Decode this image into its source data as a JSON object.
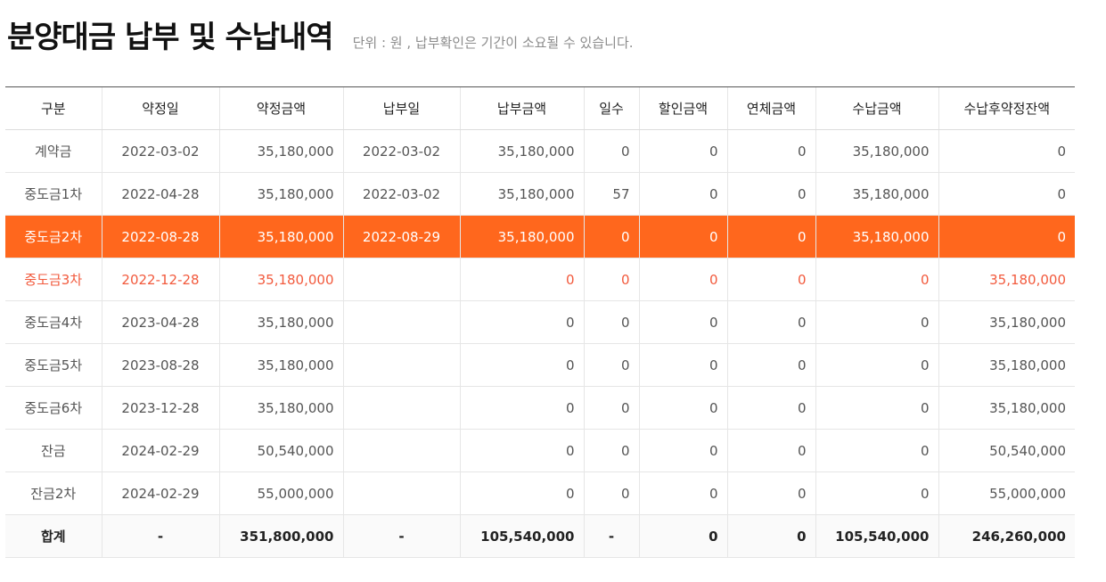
{
  "header": {
    "title": "분양대금 납부 및 수납내역",
    "subtitle": "단위 : 원 , 납부확인은 기간이 소요될 수 있습니다."
  },
  "colors": {
    "highlight_row": "#ff671d",
    "due_text": "#f25a3d"
  },
  "table": {
    "columns": [
      "구분",
      "약정일",
      "약정금액",
      "납부일",
      "납부금액",
      "일수",
      "할인금액",
      "연체금액",
      "수납금액",
      "수납후약정잔액"
    ],
    "rows": [
      [
        "계약금",
        "2022-03-02",
        "35,180,000",
        "2022-03-02",
        "35,180,000",
        "0",
        "0",
        "0",
        "35,180,000",
        "0"
      ],
      [
        "중도금1차",
        "2022-04-28",
        "35,180,000",
        "2022-03-02",
        "35,180,000",
        "57",
        "0",
        "0",
        "35,180,000",
        "0"
      ],
      [
        "중도금2차",
        "2022-08-28",
        "35,180,000",
        "2022-08-29",
        "35,180,000",
        "0",
        "0",
        "0",
        "35,180,000",
        "0"
      ],
      [
        "중도금3차",
        "2022-12-28",
        "35,180,000",
        "",
        "0",
        "0",
        "0",
        "0",
        "0",
        "35,180,000"
      ],
      [
        "중도금4차",
        "2023-04-28",
        "35,180,000",
        "",
        "0",
        "0",
        "0",
        "0",
        "0",
        "35,180,000"
      ],
      [
        "중도금5차",
        "2023-08-28",
        "35,180,000",
        "",
        "0",
        "0",
        "0",
        "0",
        "0",
        "35,180,000"
      ],
      [
        "중도금6차",
        "2023-12-28",
        "35,180,000",
        "",
        "0",
        "0",
        "0",
        "0",
        "0",
        "35,180,000"
      ],
      [
        "잔금",
        "2024-02-29",
        "50,540,000",
        "",
        "0",
        "0",
        "0",
        "0",
        "0",
        "50,540,000"
      ],
      [
        "잔금2차",
        "2024-02-29",
        "55,000,000",
        "",
        "0",
        "0",
        "0",
        "0",
        "0",
        "55,000,000"
      ]
    ],
    "total": [
      "합계",
      "-",
      "351,800,000",
      "-",
      "105,540,000",
      "-",
      "0",
      "0",
      "105,540,000",
      "246,260,000"
    ]
  }
}
